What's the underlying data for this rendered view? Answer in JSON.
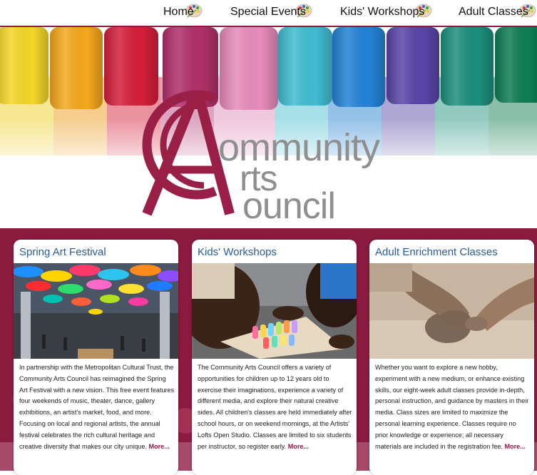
{
  "nav": {
    "items": [
      {
        "label": "Home"
      },
      {
        "label": "Special Events"
      },
      {
        "label": "Kids' Workshops"
      },
      {
        "label": "Adult Classes"
      }
    ]
  },
  "hero": {
    "logo_monogram": "CA",
    "logo_line1": "ommunity",
    "logo_line2": "rts",
    "logo_line3": "ouncil",
    "logo_line1_initial": "C",
    "logo_line2_initial": "A",
    "logo_line3_initial": "C"
  },
  "colors": {
    "brand_maroon": "#8b1a3f",
    "title_blue": "#2a5c9a",
    "logo_gray": "#8f8f8f"
  },
  "cards": [
    {
      "title": "Spring Art Festival",
      "text": "In partnership with the Metropolitan Cultural Trust, the Community Arts Council has reimagined the Spring Art Festival with a new vision. This free event features four weekends of music, theater, dance, gallery exhibitions, an artist's market, food, and more. Focusing on local and regional artists, the annual festival celebrates the rich cultural heritage and creative diversity that makes our city unique.",
      "more": "More..."
    },
    {
      "title": "Kids' Workshops",
      "text": "The Community Arts Council offers a variety of opportunities for children up to 12 years old to exercise their imaginations, experience a variety of different media, and explore their natural creative sides. All children's classes are held immediately after school hours, or on weekend mornings, at the Artists' Lofts Open Studio. Classes are limited to six students per instructor, so register early.",
      "more": "More..."
    },
    {
      "title": "Adult Enrichment Classes",
      "text": "Whether you want to explore a new hobby, experiment with a new medium, or enhance existing skills, our eight-week adult classes provide in-depth, personal instruction, and guidance by masters in their media. Class sizes are limited to maximize the personal learning experience. Classes require no prior knowledge or experience; all necessary materials are included in the registration fee.",
      "more": "More..."
    }
  ]
}
